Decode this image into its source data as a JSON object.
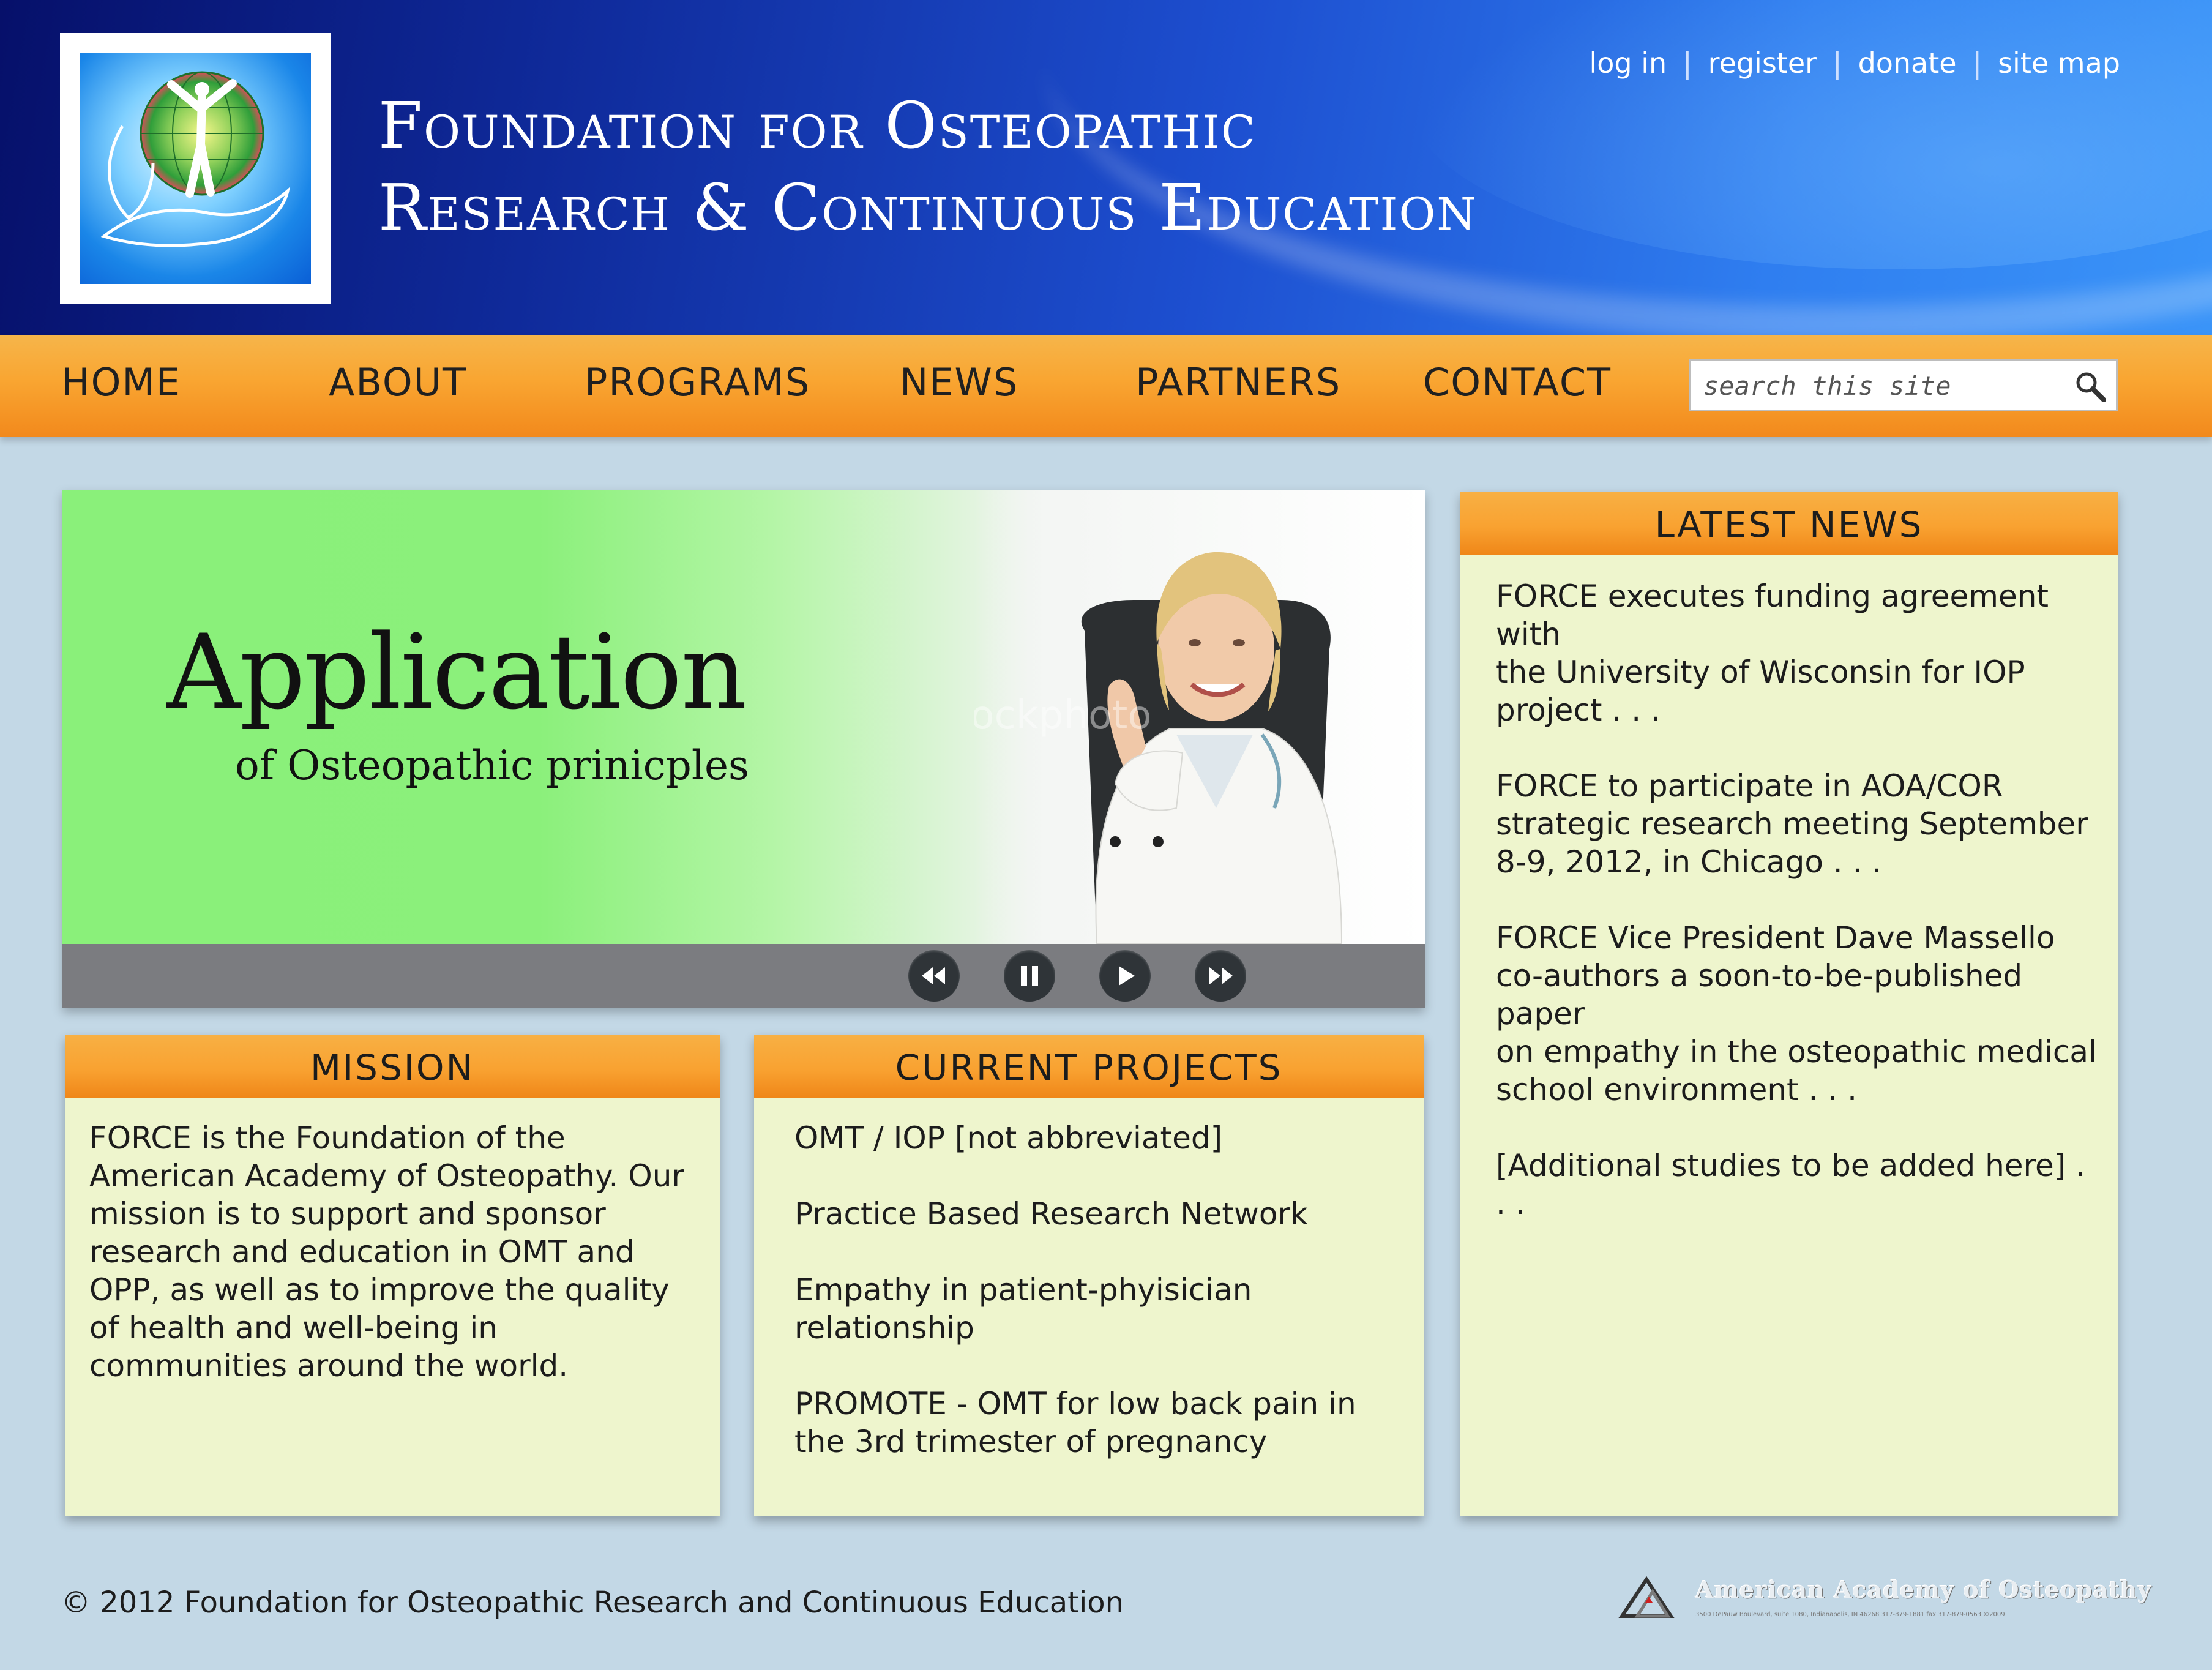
{
  "header": {
    "title_line1": "Foundation for Osteopathic",
    "title_line2": "Research & Continuous Education",
    "links": [
      "log in",
      "register",
      "donate",
      "site map"
    ]
  },
  "nav": {
    "items": [
      "HOME",
      "ABOUT",
      "PROGRAMS",
      "NEWS",
      "PARTNERS",
      "CONTACT"
    ],
    "search_placeholder": "search this site"
  },
  "slideshow": {
    "title": "Application",
    "subtitle": "of Osteopathic prinicples",
    "watermark": "iStockphoto",
    "controls": [
      "rewind-icon",
      "pause-icon",
      "play-icon",
      "fast-forward-icon"
    ]
  },
  "mission": {
    "heading": "MISSION",
    "lines": [
      "FORCE is the Foundation of the",
      "American Academy of Osteopathy. Our",
      "mission is to support and sponsor",
      "research and education in OMT and",
      "OPP, as well as to improve the quality",
      "of health and well-being in",
      "communities around the world."
    ]
  },
  "projects": {
    "heading": "CURRENT PROJECTS",
    "items": [
      [
        "OMT / IOP [not abbreviated]"
      ],
      [
        "Practice Based Research Network"
      ],
      [
        "Empathy in patient-phyisician",
        "relationship"
      ],
      [
        "PROMOTE - OMT for low back pain in",
        "the 3rd trimester of pregnancy"
      ]
    ]
  },
  "news": {
    "heading": "LATEST NEWS",
    "items": [
      [
        "FORCE executes funding agreement with",
        "the University of Wisconsin for IOP",
        "project . . ."
      ],
      [
        "FORCE to participate in AOA/COR",
        "strategic research meeting September",
        "8-9, 2012, in Chicago . . ."
      ],
      [
        "FORCE Vice President Dave Massello",
        "co-authors a soon-to-be-published paper",
        "on empathy in the osteopathic medical",
        "school environment . . ."
      ],
      [
        "[Additional studies to be added here] . . ."
      ]
    ]
  },
  "footer": {
    "copyright": "© 2012 Foundation for Osteopathic Research and Continuous Education",
    "partner_name": "American Academy of Osteopathy",
    "partner_address": "3500 DePauw Boulevard, suite 1080, Indianapolis, IN 46268  317-879-1881  fax 317-879-0563  ©2009"
  },
  "colors": {
    "nav_orange": "#f9a531",
    "panel_bg": "#eef5cd",
    "page_bg": "#c3d8e6",
    "slide_green": "#8af07a"
  }
}
